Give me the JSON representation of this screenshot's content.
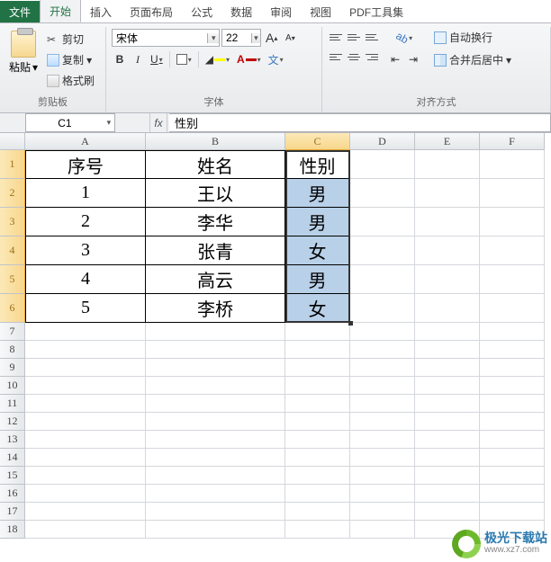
{
  "tabs": {
    "file": "文件",
    "items": [
      "开始",
      "插入",
      "页面布局",
      "公式",
      "数据",
      "审阅",
      "视图",
      "PDF工具集"
    ],
    "active": 0
  },
  "ribbon": {
    "clipboard": {
      "label": "剪贴板",
      "paste": "粘贴",
      "cut": "剪切",
      "copy": "复制",
      "format_painter": "格式刷"
    },
    "font": {
      "label": "字体",
      "name": "宋体",
      "size": "22",
      "grow": "A",
      "shrink": "A",
      "bold": "B",
      "italic": "I",
      "underline": "U"
    },
    "align": {
      "label": "对齐方式",
      "wrap": "自动换行",
      "merge": "合并后居中"
    }
  },
  "nameBox": "C1",
  "formula": "性别",
  "cols": [
    {
      "label": "A",
      "w": 134
    },
    {
      "label": "B",
      "w": 155
    },
    {
      "label": "C",
      "w": 72
    },
    {
      "label": "D",
      "w": 72
    },
    {
      "label": "E",
      "w": 72
    },
    {
      "label": "F",
      "w": 72
    }
  ],
  "rowsData": [
    {
      "h": 32,
      "a": "序号",
      "b": "姓名",
      "c": "性别"
    },
    {
      "h": 32,
      "a": "1",
      "b": "王以",
      "c": "男"
    },
    {
      "h": 32,
      "a": "2",
      "b": "李华",
      "c": "男"
    },
    {
      "h": 32,
      "a": "3",
      "b": "张青",
      "c": "女"
    },
    {
      "h": 32,
      "a": "4",
      "b": "高云",
      "c": "男"
    },
    {
      "h": 32,
      "a": "5",
      "b": "李桥",
      "c": "女"
    }
  ],
  "emptyRows": 12,
  "emptyRowH": 20,
  "watermark": {
    "cn": "极光下载站",
    "en": "www.xz7.com"
  }
}
